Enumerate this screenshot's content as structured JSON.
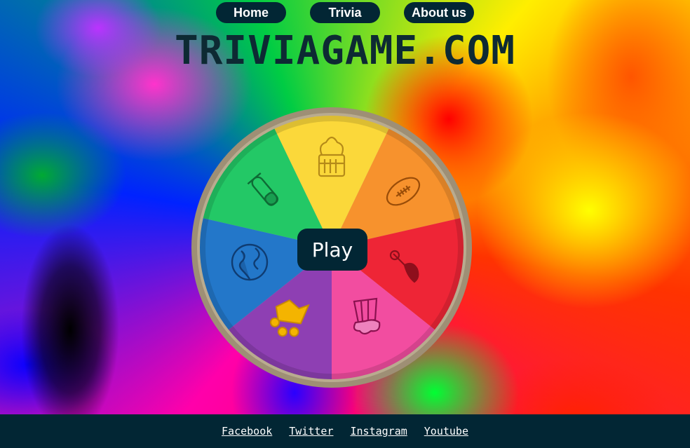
{
  "nav": {
    "home": "Home",
    "trivia": "Trivia",
    "about": "About us"
  },
  "title": "TRIVIAGAME.COM",
  "play_label": "Play",
  "footer": {
    "links": [
      "Facebook",
      "Twitter",
      "Instagram",
      "Youtube"
    ]
  },
  "wheel": {
    "segments": [
      {
        "color": "#fbd83a",
        "icon": "crown-icon"
      },
      {
        "color": "#f7922d",
        "icon": "football-icon"
      },
      {
        "color": "#ee2536",
        "icon": "paintbrush-icon"
      },
      {
        "color": "#f24da0",
        "icon": "popcorn-icon"
      },
      {
        "color": "#8e3fb3",
        "icon": "flask-icon"
      },
      {
        "color": "#2377c9",
        "icon": "globe-icon"
      },
      {
        "color": "#23c866",
        "icon": "test-tube-icon"
      }
    ],
    "rim_color": "#9e8f75",
    "accent_icon_color": "#f4b400"
  }
}
